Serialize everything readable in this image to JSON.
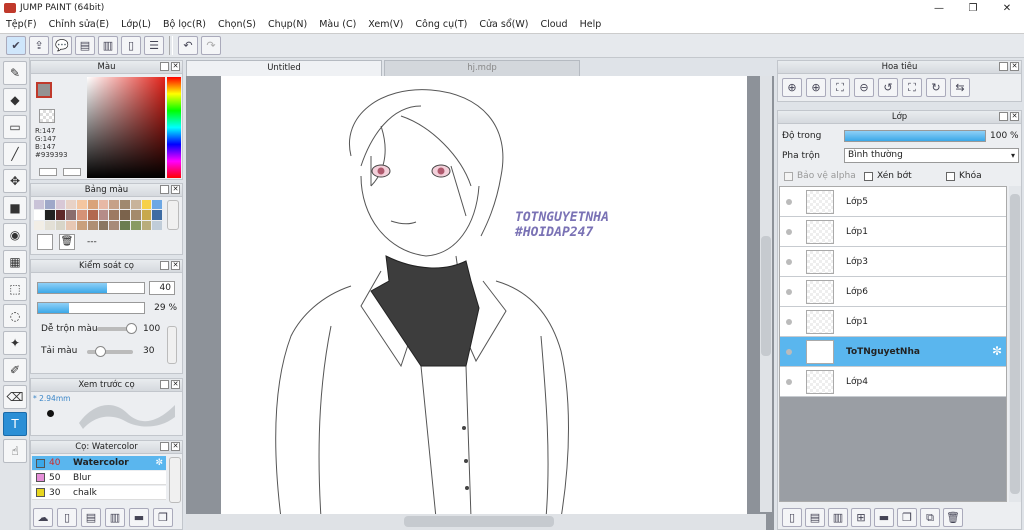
{
  "window": {
    "title": "JUMP PAINT (64bit)",
    "controls": [
      "—",
      "❐",
      "✕"
    ]
  },
  "menu": [
    "Tệp(F)",
    "Chỉnh sửa(E)",
    "Lớp(L)",
    "Bộ lọc(R)",
    "Chọn(S)",
    "Chụp(N)",
    "Màu (C)",
    "Xem(V)",
    "Công cụ(T)",
    "Cửa sổ(W)",
    "Cloud",
    "Help"
  ],
  "tabs": {
    "active": "Untitled",
    "inactive": "hj.mdp"
  },
  "color_panel": {
    "title": "Màu",
    "r": "R:147",
    "g": "G:147",
    "b": "B:147",
    "hex": "#939393",
    "current_color": "#939393"
  },
  "swatch_panel": {
    "title": "Bảng màu",
    "placeholder": "---"
  },
  "brush_control": {
    "title": "Kiểm soát cọ",
    "size_value": "40",
    "size_fill": 0.65,
    "opacity_value": "29 %",
    "opacity_fill": 0.29,
    "mix_label": "Dễ trộn màu",
    "mix_value": "100",
    "load_label": "Tải màu",
    "load_value": "30"
  },
  "brush_preview": {
    "title": "Xem trước cọ",
    "size_text": "* 2.94mm"
  },
  "brush_list": {
    "title": "Cọ: Watercolor",
    "items": [
      {
        "size": "40",
        "name": "Watercolor",
        "color": "#3ba8e8",
        "selected": true
      },
      {
        "size": "50",
        "name": "Blur",
        "color": "#e58fd8",
        "selected": false
      },
      {
        "size": "30",
        "name": "chalk",
        "color": "#e8d61e",
        "selected": false
      }
    ]
  },
  "navigator": {
    "title": "Hoa tiêu"
  },
  "layers": {
    "title": "Lớp",
    "opacity_label": "Độ trong",
    "opacity_value": "100 %",
    "blend_label": "Pha trộn",
    "blend_value": "Bình thường",
    "protect_alpha": "Bảo vệ alpha",
    "clip": "Xén bớt",
    "lock": "Khóa",
    "items": [
      "Lớp5",
      "Lớp1",
      "Lớp3",
      "Lớp6",
      "Lớp1",
      "ToTNguyetNha",
      "Lớp4"
    ],
    "selected_index": 5
  },
  "canvas_text": {
    "line1": "TOTNGUYETNHA",
    "line2": "#HOIDAP247"
  }
}
